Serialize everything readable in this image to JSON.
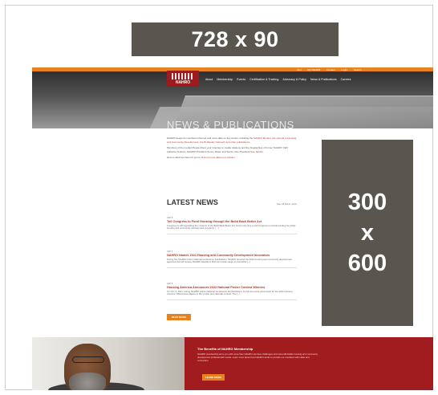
{
  "ads": {
    "leaderboard": "728 x 90",
    "skyscraper": [
      "300",
      "x",
      "600"
    ]
  },
  "header": {
    "utility_links": [
      "Join",
      "My NAHRO",
      "Contact",
      "Login",
      "Search"
    ],
    "logo_text": "NAHRO",
    "nav": [
      "About",
      "Membership",
      "Events",
      "Certification & Training",
      "Advocacy & Policy",
      "News & Publications",
      "Careers"
    ],
    "page_title": "NEWS & PUBLICATIONS"
  },
  "intro": {
    "p1": "NAHRO keeps its members informed and up-to-date on key issues, including the ",
    "p1_link": "NAHRO Monitor, the Journal of Housing and Community Development, the Bi-Weekly Outreach and other publications.",
    "p2": "Members of the media! Please direct your inquiries to media relations and the biographies of former NAHRO CEO Adrianne Todman, NAHRO President Sunny Shaw, and Senior Vice President ",
    "p2_link": "Sue Jacobs.",
    "p3": "Here is what we have for you to ",
    "p3_link": "find out more about our mission"
  },
  "latest_news": {
    "title": "LATEST NEWS",
    "view_all": "See all latest news",
    "items": [
      {
        "date": "SEP 8",
        "title": "Toll Congress to Fund Housing through the Build Back Better Act",
        "excerpt": "Congress is still negotiating the contents of the Build Back Better Act. Now is the time to tell Congress to include funding for public housing and community development programs. [...]"
      },
      {
        "date": "SEP 8",
        "title": "NAHRO Names 2021 Housing and Community Development Innovators",
        "excerpt": "During the NAHRO Online National Conference & Exhibition, NAHRO honored the 2021 housing and community development agencies that will receive NAHRO Awards of Merit for a wide range of innovative [...]"
      },
      {
        "date": "SEP 8",
        "title": "Housing America Announces 2022 National Poster Contest Winners",
        "excerpt": "On Oct. 4, 2021, during NAHRO Online National Conference and Exhibition, 13 winners were announced for the 2022 Housing America \"What Home Means to Me\" poster and calendar contest. The [...]"
      }
    ],
    "read_more": "READ MORE"
  },
  "benefits": {
    "title": "The Benefits of NAHRO Membership",
    "text": "NAHRO membership arms you with more than NAHRO can face challenges and meet affordable housing and community development professionals' needs. Learn more about how NAHRO works to provide our members with value and connection.",
    "button": "LEARN MORE"
  },
  "colors": {
    "brand_red": "#a01c1f",
    "accent_orange": "#e8821e",
    "ad_gray": "#5b5550"
  }
}
